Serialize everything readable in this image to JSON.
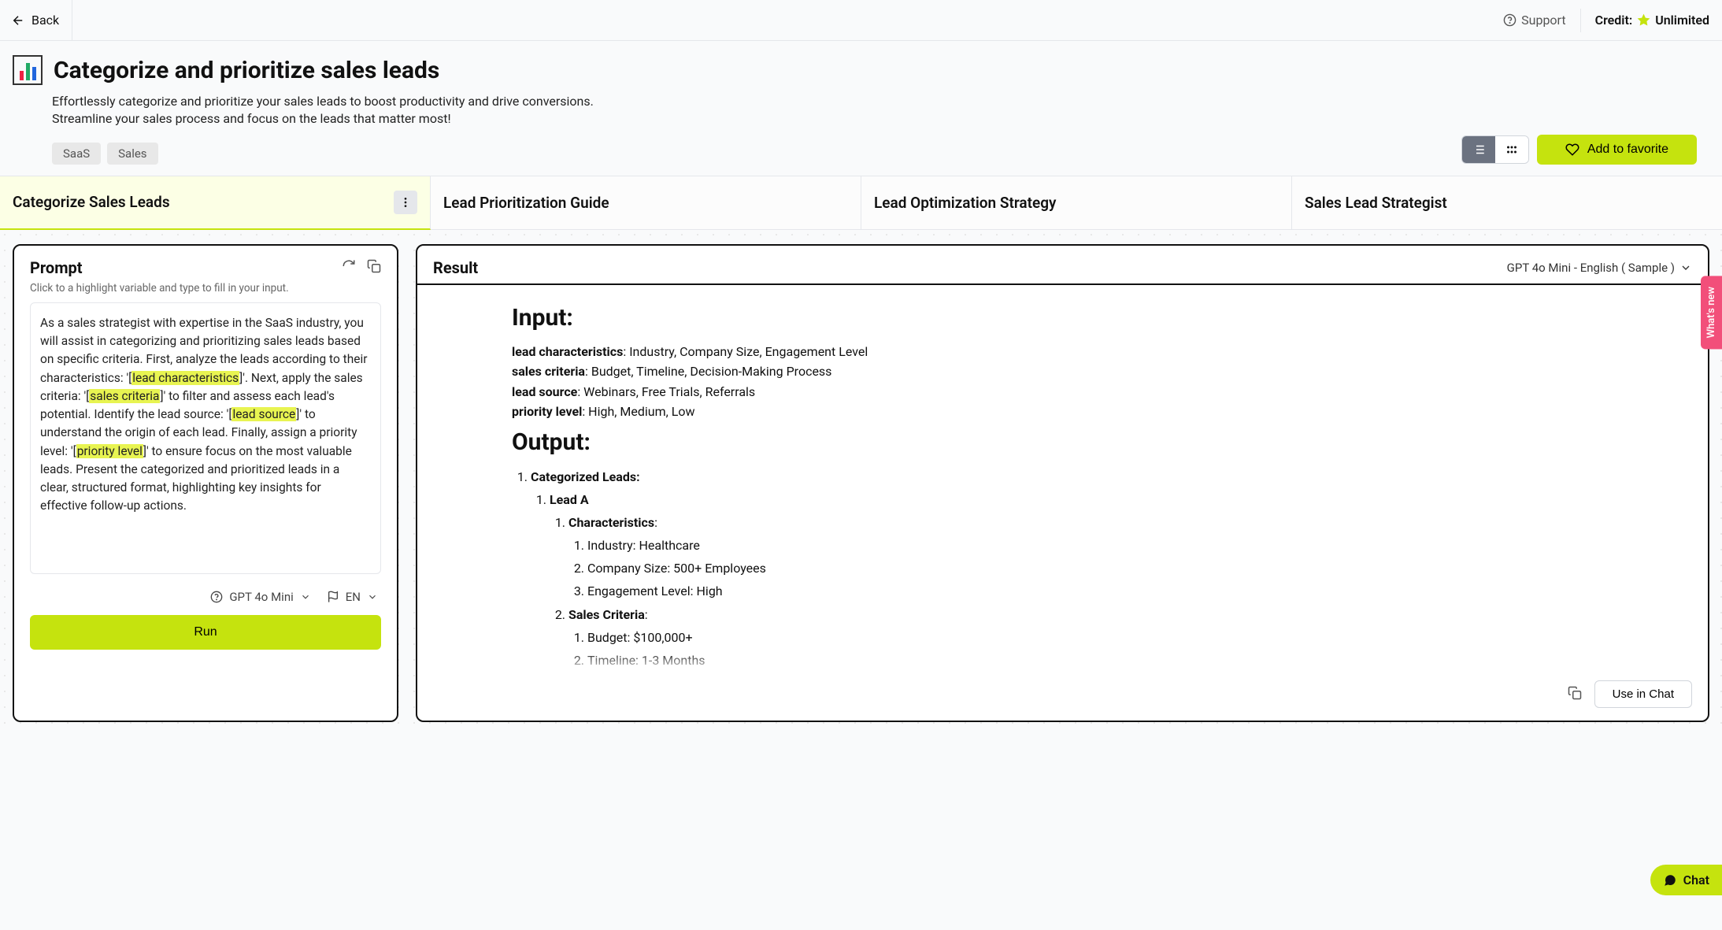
{
  "topbar": {
    "back": "Back",
    "support": "Support",
    "credit_label": "Credit:",
    "credit_value": "Unlimited"
  },
  "header": {
    "title": "Categorize and prioritize sales leads",
    "description": "Effortlessly categorize and prioritize your sales leads to boost productivity and drive conversions. Streamline your sales process and focus on the leads that matter most!",
    "tags": [
      "SaaS",
      "Sales"
    ],
    "favorite": "Add to favorite"
  },
  "tabs": [
    "Categorize Sales Leads",
    "Lead Prioritization Guide",
    "Lead Optimization Strategy",
    "Sales Lead Strategist"
  ],
  "prompt": {
    "title": "Prompt",
    "hint": "Click to a highlight variable and type to fill in your input.",
    "t1": "As a sales strategist with expertise in the SaaS industry, you will assist in categorizing and prioritizing sales leads based on specific criteria. First, analyze the leads according to their characteristics: '[",
    "v1": "lead characteristics",
    "t2": "]'. Next, apply the sales criteria: '[",
    "v2": "sales criteria",
    "t3": "]' to filter and assess each lead's potential. Identify the lead source: '[",
    "v3": "lead source",
    "t4": "]' to understand the origin of each lead. Finally, assign a priority level: '[",
    "v4": "priority level",
    "t5": "]' to ensure focus on the most valuable leads. Present the categorized and prioritized leads in a clear, structured format, highlighting key insights for effective follow-up actions.",
    "model": "GPT 4o Mini",
    "lang": "EN",
    "run": "Run"
  },
  "result": {
    "title": "Result",
    "model": "GPT 4o Mini - English ( Sample )",
    "input_heading": "Input:",
    "input": {
      "k1": "lead characteristics",
      "v1": ": Industry, Company Size, Engagement Level",
      "k2": "sales criteria",
      "v2": ": Budget, Timeline, Decision-Making Process",
      "k3": "lead source",
      "v3": ": Webinars, Free Trials, Referrals",
      "k4": "priority level",
      "v4": ": High, Medium, Low"
    },
    "output_heading": "Output:",
    "output": {
      "l1": "Categorized Leads:",
      "l2": "Lead A",
      "l3": "Characteristics",
      "l3_1": "Industry: Healthcare",
      "l3_2": "Company Size: 500+ Employees",
      "l3_3": "Engagement Level: High",
      "l4": "Sales Criteria",
      "l4_1": "Budget: $100,000+",
      "l4_2": "Timeline: 1-3 Months"
    },
    "use_in_chat": "Use in Chat"
  },
  "sidebar": {
    "whats_new": "What's new",
    "chat": "Chat"
  }
}
